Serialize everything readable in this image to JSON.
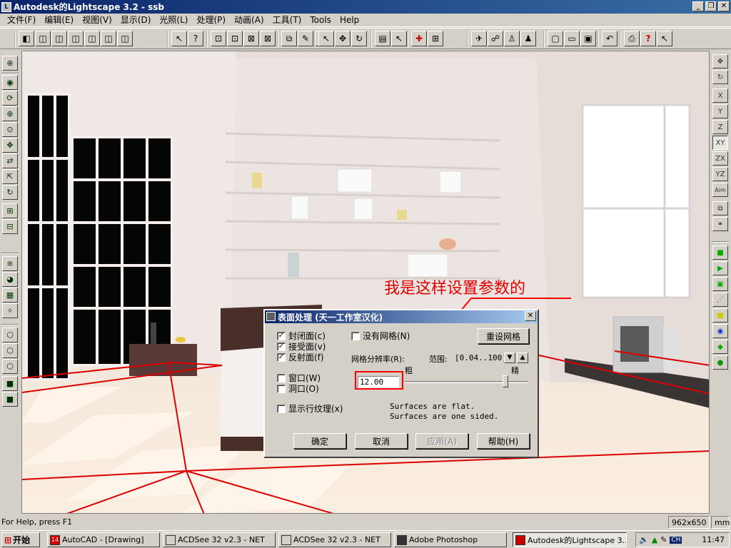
{
  "window": {
    "title": "Autodesk的Lightscape 3.2  - ssb",
    "controls": [
      "_",
      "❐",
      "✕"
    ]
  },
  "menubar": {
    "items": [
      "文件(F)",
      "编辑(E)",
      "视图(V)",
      "显示(D)",
      "光照(L)",
      "处理(P)",
      "动画(A)",
      "工具(T)",
      "Tools",
      "Help"
    ]
  },
  "statusbar": {
    "help_text": "For Help, press F1",
    "size": "962x650",
    "unit": "mm"
  },
  "taskbar": {
    "start_label": "开始",
    "tasks": [
      {
        "label": "AutoCAD - [Drawing]",
        "icon": "autocad-icon"
      },
      {
        "label": "ACDSee 32 v2.3 - NET",
        "icon": "acdsee-icon"
      },
      {
        "label": "ACDSee 32 v2.3 - NET",
        "icon": "acdsee-icon"
      },
      {
        "label": "Adobe Photoshop",
        "icon": "photoshop-icon"
      },
      {
        "label": "Autodesk的Lightscape 3....",
        "icon": "lightscape-icon"
      }
    ],
    "tray_lang": "CH",
    "clock": "11:47"
  },
  "annotation": {
    "text": "我是这样设置参数的"
  },
  "dialog": {
    "title": "表面处理  (天一工作室汉化)",
    "checkboxes": {
      "closed_face": {
        "label": "封闭面(c)",
        "checked": true
      },
      "receive_face": {
        "label": "接受面(v)",
        "checked": true
      },
      "reflect_face": {
        "label": "反射面(f)",
        "checked": true
      },
      "window": {
        "label": "窗口(W)",
        "checked": false
      },
      "hole": {
        "label": "洞口(O)",
        "checked": false
      },
      "show_texture": {
        "label": "显示行纹理(x)",
        "checked": false
      },
      "no_mesh": {
        "label": "没有网格(N)",
        "checked": false
      }
    },
    "reset_mesh_label": "重设网格",
    "mesh_resolution_label": "网格分辨率(R):",
    "range_label": "范围:",
    "range_value": "[0.04..100]",
    "coarse_label": "粗",
    "fine_label": "精",
    "resolution_value": "12.00",
    "slider_position": 0.82,
    "info_line1": "Surfaces are flat.",
    "info_line2": "Surfaces are one sided.",
    "buttons": {
      "ok": "确定",
      "cancel": "取消",
      "apply": "应用(A)",
      "help": "帮助(H)"
    }
  },
  "colors": {
    "title_gradient_start": "#0a246a",
    "mesh_line": "#dd0000",
    "annotation": "#e00000"
  }
}
